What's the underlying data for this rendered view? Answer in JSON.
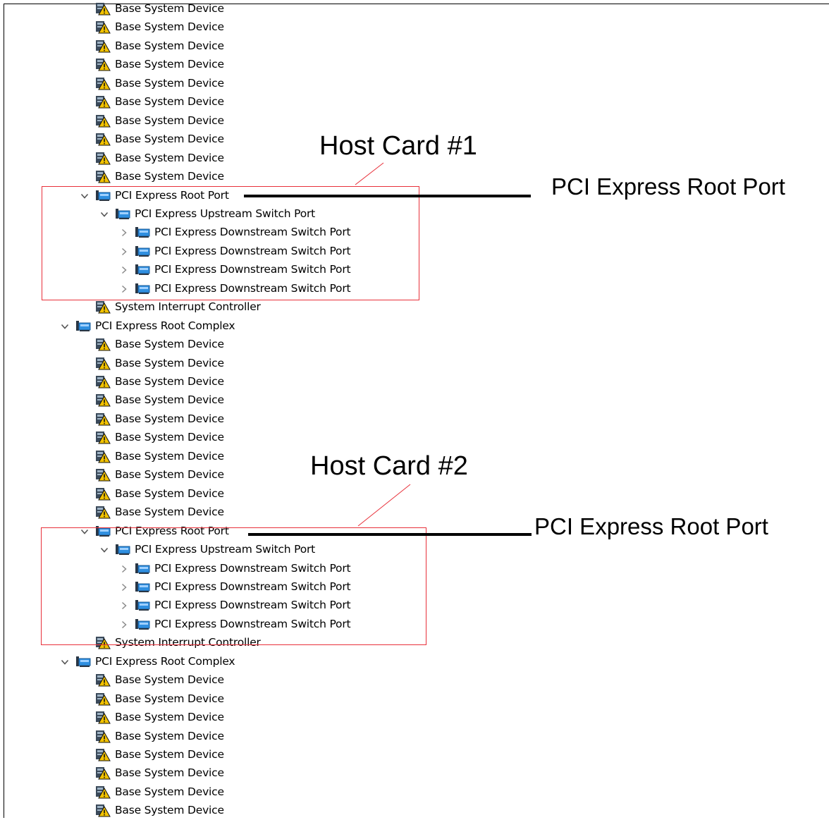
{
  "tree": {
    "rows": [
      {
        "label": "Base System Device",
        "icon": "warning-device-icon",
        "indent": 2,
        "expander": "none",
        "y": 0,
        "cut_top": true
      },
      {
        "label": "Base System Device",
        "icon": "warning-device-icon",
        "indent": 2,
        "expander": "none"
      },
      {
        "label": "Base System Device",
        "icon": "warning-device-icon",
        "indent": 2,
        "expander": "none"
      },
      {
        "label": "Base System Device",
        "icon": "warning-device-icon",
        "indent": 2,
        "expander": "none"
      },
      {
        "label": "Base System Device",
        "icon": "warning-device-icon",
        "indent": 2,
        "expander": "none"
      },
      {
        "label": "Base System Device",
        "icon": "warning-device-icon",
        "indent": 2,
        "expander": "none"
      },
      {
        "label": "Base System Device",
        "icon": "warning-device-icon",
        "indent": 2,
        "expander": "none"
      },
      {
        "label": "Base System Device",
        "icon": "warning-device-icon",
        "indent": 2,
        "expander": "none"
      },
      {
        "label": "Base System Device",
        "icon": "warning-device-icon",
        "indent": 2,
        "expander": "none"
      },
      {
        "label": "Base System Device",
        "icon": "warning-device-icon",
        "indent": 2,
        "expander": "none"
      },
      {
        "label": "PCI Express Root Port",
        "icon": "pci-device-icon",
        "indent": 2,
        "expander": "expanded"
      },
      {
        "label": "PCI Express Upstream Switch Port",
        "icon": "pci-device-icon",
        "indent": 3,
        "expander": "expanded"
      },
      {
        "label": "PCI Express Downstream Switch Port",
        "icon": "pci-device-icon",
        "indent": 4,
        "expander": "collapsed"
      },
      {
        "label": "PCI Express Downstream Switch Port",
        "icon": "pci-device-icon",
        "indent": 4,
        "expander": "collapsed"
      },
      {
        "label": "PCI Express Downstream Switch Port",
        "icon": "pci-device-icon",
        "indent": 4,
        "expander": "collapsed"
      },
      {
        "label": "PCI Express Downstream Switch Port",
        "icon": "pci-device-icon",
        "indent": 4,
        "expander": "collapsed"
      },
      {
        "label": "System Interrupt Controller",
        "icon": "warning-device-icon",
        "indent": 2,
        "expander": "none"
      },
      {
        "label": "PCI Express Root Complex",
        "icon": "pci-device-icon",
        "indent": 1,
        "expander": "expanded"
      },
      {
        "label": "Base System Device",
        "icon": "warning-device-icon",
        "indent": 2,
        "expander": "none"
      },
      {
        "label": "Base System Device",
        "icon": "warning-device-icon",
        "indent": 2,
        "expander": "none"
      },
      {
        "label": "Base System Device",
        "icon": "warning-device-icon",
        "indent": 2,
        "expander": "none"
      },
      {
        "label": "Base System Device",
        "icon": "warning-device-icon",
        "indent": 2,
        "expander": "none"
      },
      {
        "label": "Base System Device",
        "icon": "warning-device-icon",
        "indent": 2,
        "expander": "none"
      },
      {
        "label": "Base System Device",
        "icon": "warning-device-icon",
        "indent": 2,
        "expander": "none"
      },
      {
        "label": "Base System Device",
        "icon": "warning-device-icon",
        "indent": 2,
        "expander": "none"
      },
      {
        "label": "Base System Device",
        "icon": "warning-device-icon",
        "indent": 2,
        "expander": "none"
      },
      {
        "label": "Base System Device",
        "icon": "warning-device-icon",
        "indent": 2,
        "expander": "none"
      },
      {
        "label": "Base System Device",
        "icon": "warning-device-icon",
        "indent": 2,
        "expander": "none"
      },
      {
        "label": "PCI Express Root Port",
        "icon": "pci-device-icon",
        "indent": 2,
        "expander": "expanded"
      },
      {
        "label": "PCI Express Upstream Switch Port",
        "icon": "pci-device-icon",
        "indent": 3,
        "expander": "expanded"
      },
      {
        "label": "PCI Express Downstream Switch Port",
        "icon": "pci-device-icon",
        "indent": 4,
        "expander": "collapsed"
      },
      {
        "label": "PCI Express Downstream Switch Port",
        "icon": "pci-device-icon",
        "indent": 4,
        "expander": "collapsed"
      },
      {
        "label": "PCI Express Downstream Switch Port",
        "icon": "pci-device-icon",
        "indent": 4,
        "expander": "collapsed"
      },
      {
        "label": "PCI Express Downstream Switch Port",
        "icon": "pci-device-icon",
        "indent": 4,
        "expander": "collapsed"
      },
      {
        "label": "System Interrupt Controller",
        "icon": "warning-device-icon",
        "indent": 2,
        "expander": "none"
      },
      {
        "label": "PCI Express Root Complex",
        "icon": "pci-device-icon",
        "indent": 1,
        "expander": "expanded"
      },
      {
        "label": "Base System Device",
        "icon": "warning-device-icon",
        "indent": 2,
        "expander": "none"
      },
      {
        "label": "Base System Device",
        "icon": "warning-device-icon",
        "indent": 2,
        "expander": "none"
      },
      {
        "label": "Base System Device",
        "icon": "warning-device-icon",
        "indent": 2,
        "expander": "none"
      },
      {
        "label": "Base System Device",
        "icon": "warning-device-icon",
        "indent": 2,
        "expander": "none"
      },
      {
        "label": "Base System Device",
        "icon": "warning-device-icon",
        "indent": 2,
        "expander": "none"
      },
      {
        "label": "Base System Device",
        "icon": "warning-device-icon",
        "indent": 2,
        "expander": "none"
      },
      {
        "label": "Base System Device",
        "icon": "warning-device-icon",
        "indent": 2,
        "expander": "none"
      },
      {
        "label": "Base System Device",
        "icon": "warning-device-icon",
        "indent": 2,
        "expander": "none"
      }
    ]
  },
  "annotations": {
    "host_card_1": "Host Card #1",
    "host_card_2": "Host Card #2",
    "root_port_1": "PCI Express Root Port",
    "root_port_2": "PCI Express Root Port",
    "box_color": "#e8303a",
    "leader_color": "#000000"
  },
  "colors": {
    "pci_icon_blue": "#2f8fe0",
    "warning_yellow": "#f2c200",
    "chevron": "#555555"
  }
}
